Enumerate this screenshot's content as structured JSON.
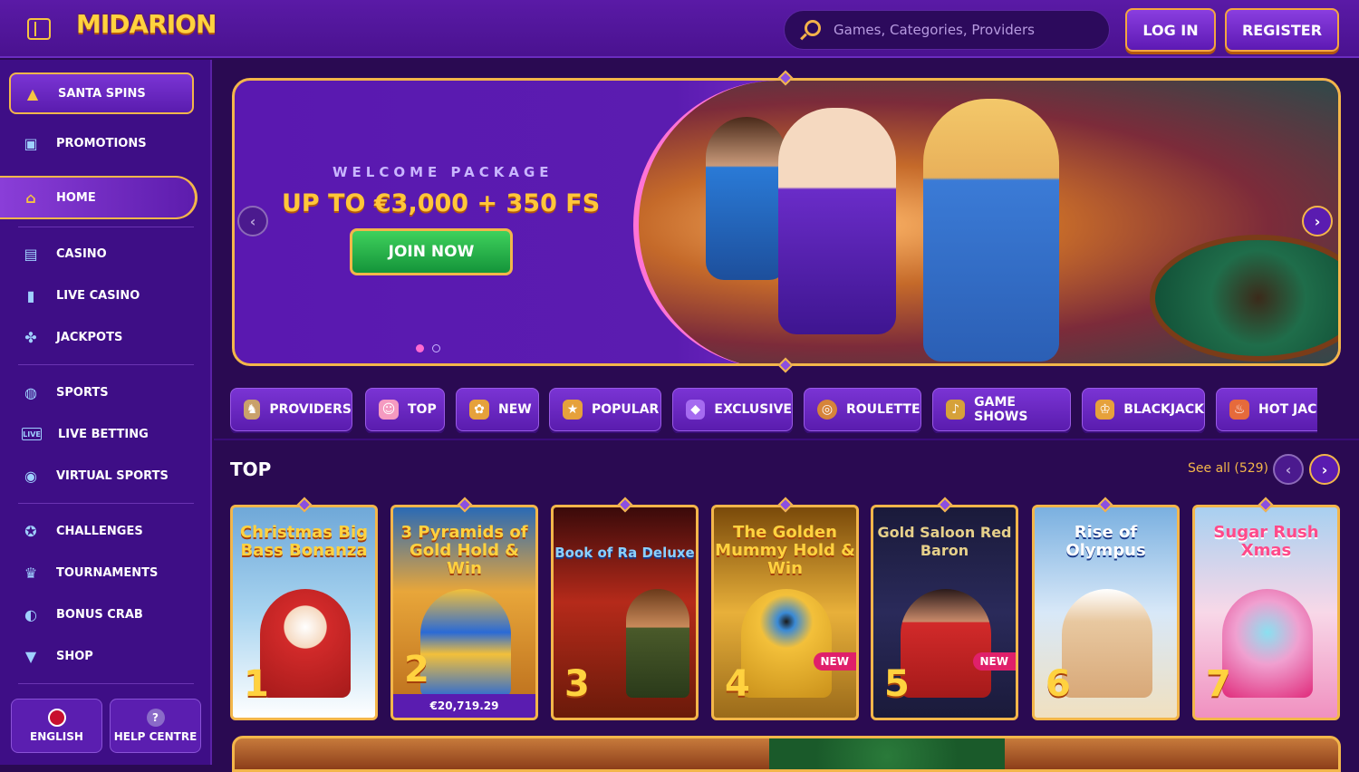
{
  "header": {
    "logo": "MIDARION",
    "search_placeholder": "Games, Categories, Providers",
    "login_label": "LOG IN",
    "register_label": "REGISTER"
  },
  "sidebar": {
    "items": [
      {
        "label": "SANTA SPINS",
        "icon": "bell-icon"
      },
      {
        "label": "PROMOTIONS",
        "icon": "gift-icon"
      },
      {
        "label": "HOME",
        "icon": "home-icon"
      },
      {
        "label": "CASINO",
        "icon": "slot-machine-icon"
      },
      {
        "label": "LIVE CASINO",
        "icon": "card-icon"
      },
      {
        "label": "JACKPOTS",
        "icon": "clover-icon"
      },
      {
        "label": "SPORTS",
        "icon": "ball-icon"
      },
      {
        "label": "LIVE BETTING",
        "icon": "live-icon"
      },
      {
        "label": "VIRTUAL SPORTS",
        "icon": "gamepad-icon"
      },
      {
        "label": "CHALLENGES",
        "icon": "medal-icon"
      },
      {
        "label": "TOURNAMENTS",
        "icon": "trophy-icon"
      },
      {
        "label": "BONUS CRAB",
        "icon": "crab-icon"
      },
      {
        "label": "SHOP",
        "icon": "basket-icon"
      }
    ],
    "language_label": "ENGLISH",
    "help_label": "HELP CENTRE",
    "live_badge": "LIVE"
  },
  "banner": {
    "welcome": "WELCOME PACKAGE",
    "offer": "UP TO €3,000 + 350 FS",
    "cta": "JOIN NOW"
  },
  "categories": [
    {
      "label": "PROVIDERS",
      "icon": "providers-icon"
    },
    {
      "label": "TOP",
      "icon": "top-icon"
    },
    {
      "label": "NEW",
      "icon": "new-icon"
    },
    {
      "label": "POPULAR",
      "icon": "star-icon"
    },
    {
      "label": "EXCLUSIVE",
      "icon": "gem-icon"
    },
    {
      "label": "ROULETTE",
      "icon": "roulette-icon"
    },
    {
      "label": "GAME SHOWS",
      "icon": "mic-icon"
    },
    {
      "label": "BLACKJACK",
      "icon": "crown-icon"
    },
    {
      "label": "HOT JACK",
      "icon": "fire-icon"
    }
  ],
  "top_section": {
    "title": "TOP",
    "see_all": "See all (529)"
  },
  "games": [
    {
      "title": "Christmas Big Bass Bonanza",
      "rank": "1",
      "badge": "",
      "jackpot": ""
    },
    {
      "title": "3 Pyramids of Gold Hold & Win",
      "rank": "2",
      "badge": "",
      "jackpot": "€20,719.29"
    },
    {
      "title": "Book of Ra Deluxe",
      "rank": "3",
      "badge": "",
      "jackpot": ""
    },
    {
      "title": "The Golden Mummy Hold & Win",
      "rank": "4",
      "badge": "NEW",
      "jackpot": ""
    },
    {
      "title": "Gold Saloon Red Baron",
      "rank": "5",
      "badge": "NEW",
      "jackpot": ""
    },
    {
      "title": "Rise of Olympus",
      "rank": "6",
      "badge": "",
      "jackpot": ""
    },
    {
      "title": "Sugar Rush Xmas",
      "rank": "7",
      "badge": "",
      "jackpot": ""
    }
  ]
}
